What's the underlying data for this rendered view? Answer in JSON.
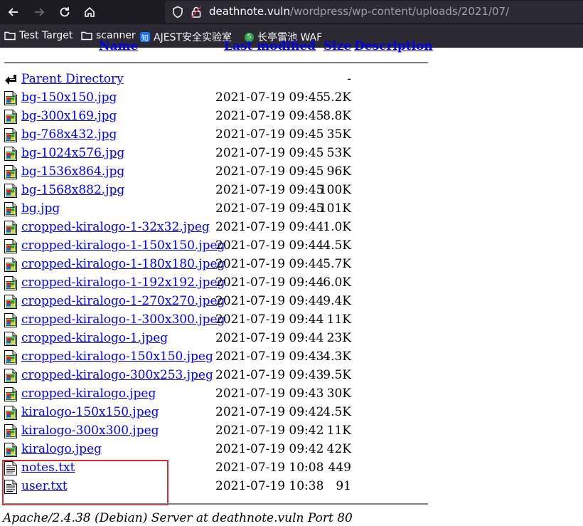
{
  "browser": {
    "url_host": "deathnote.vuln",
    "url_path": "/wordpress/wp-content/uploads/2021/07/",
    "bookmarks": [
      {
        "label": "Test Target",
        "icon": "folder-icon"
      },
      {
        "label": "scanner",
        "icon": "folder-icon"
      },
      {
        "label": "AJEST安全实验室",
        "icon": "zhihu-icon",
        "badge": "知"
      },
      {
        "label": "长亭雷池 WAF",
        "icon": "safeline-icon",
        "badge": "S"
      }
    ]
  },
  "listing": {
    "headers": {
      "name": "Name",
      "last_modified": "Last modified",
      "size": "Size",
      "description": "Description"
    },
    "parent": {
      "name": "Parent Directory",
      "size": "-"
    },
    "files": [
      {
        "name": "bg-150x150.jpg",
        "date": "2021-07-19 09:45",
        "size": "5.2K",
        "icon": "image-icon"
      },
      {
        "name": "bg-300x169.jpg",
        "date": "2021-07-19 09:45",
        "size": "8.8K",
        "icon": "image-icon"
      },
      {
        "name": "bg-768x432.jpg",
        "date": "2021-07-19 09:45",
        "size": "35K",
        "icon": "image-icon"
      },
      {
        "name": "bg-1024x576.jpg",
        "date": "2021-07-19 09:45",
        "size": "53K",
        "icon": "image-icon"
      },
      {
        "name": "bg-1536x864.jpg",
        "date": "2021-07-19 09:45",
        "size": "96K",
        "icon": "image-icon"
      },
      {
        "name": "bg-1568x882.jpg",
        "date": "2021-07-19 09:45",
        "size": "100K",
        "icon": "image-icon"
      },
      {
        "name": "bg.jpg",
        "date": "2021-07-19 09:45",
        "size": "101K",
        "icon": "image-icon"
      },
      {
        "name": "cropped-kiralogo-1-32x32.jpeg",
        "date": "2021-07-19 09:44",
        "size": "1.0K",
        "icon": "image-icon"
      },
      {
        "name": "cropped-kiralogo-1-150x150.jpeg",
        "date": "2021-07-19 09:44",
        "size": "4.5K",
        "icon": "image-icon"
      },
      {
        "name": "cropped-kiralogo-1-180x180.jpeg",
        "date": "2021-07-19 09:44",
        "size": "5.7K",
        "icon": "image-icon"
      },
      {
        "name": "cropped-kiralogo-1-192x192.jpeg",
        "date": "2021-07-19 09:44",
        "size": "6.0K",
        "icon": "image-icon"
      },
      {
        "name": "cropped-kiralogo-1-270x270.jpeg",
        "date": "2021-07-19 09:44",
        "size": "9.4K",
        "icon": "image-icon"
      },
      {
        "name": "cropped-kiralogo-1-300x300.jpeg",
        "date": "2021-07-19 09:44",
        "size": "11K",
        "icon": "image-icon"
      },
      {
        "name": "cropped-kiralogo-1.jpeg",
        "date": "2021-07-19 09:44",
        "size": "23K",
        "icon": "image-icon"
      },
      {
        "name": "cropped-kiralogo-150x150.jpeg",
        "date": "2021-07-19 09:43",
        "size": "4.3K",
        "icon": "image-icon"
      },
      {
        "name": "cropped-kiralogo-300x253.jpeg",
        "date": "2021-07-19 09:43",
        "size": "9.5K",
        "icon": "image-icon"
      },
      {
        "name": "cropped-kiralogo.jpeg",
        "date": "2021-07-19 09:43",
        "size": "30K",
        "icon": "image-icon"
      },
      {
        "name": "kiralogo-150x150.jpeg",
        "date": "2021-07-19 09:42",
        "size": "4.5K",
        "icon": "image-icon"
      },
      {
        "name": "kiralogo-300x300.jpeg",
        "date": "2021-07-19 09:42",
        "size": "11K",
        "icon": "image-icon"
      },
      {
        "name": "kiralogo.jpeg",
        "date": "2021-07-19 09:42",
        "size": "42K",
        "icon": "image-icon"
      },
      {
        "name": "notes.txt",
        "date": "2021-07-19 10:08",
        "size": "449",
        "icon": "text-file-icon"
      },
      {
        "name": "user.txt",
        "date": "2021-07-19 10:38",
        "size": "91",
        "icon": "text-file-icon"
      }
    ],
    "footer": "Apache/2.4.38 (Debian) Server at deathnote.vuln Port 80"
  },
  "colors": {
    "link": "#0000ee",
    "highlight": "#d32f2f",
    "toolbar": "#1c1b22",
    "bookmark_bar": "#2b2a33"
  }
}
